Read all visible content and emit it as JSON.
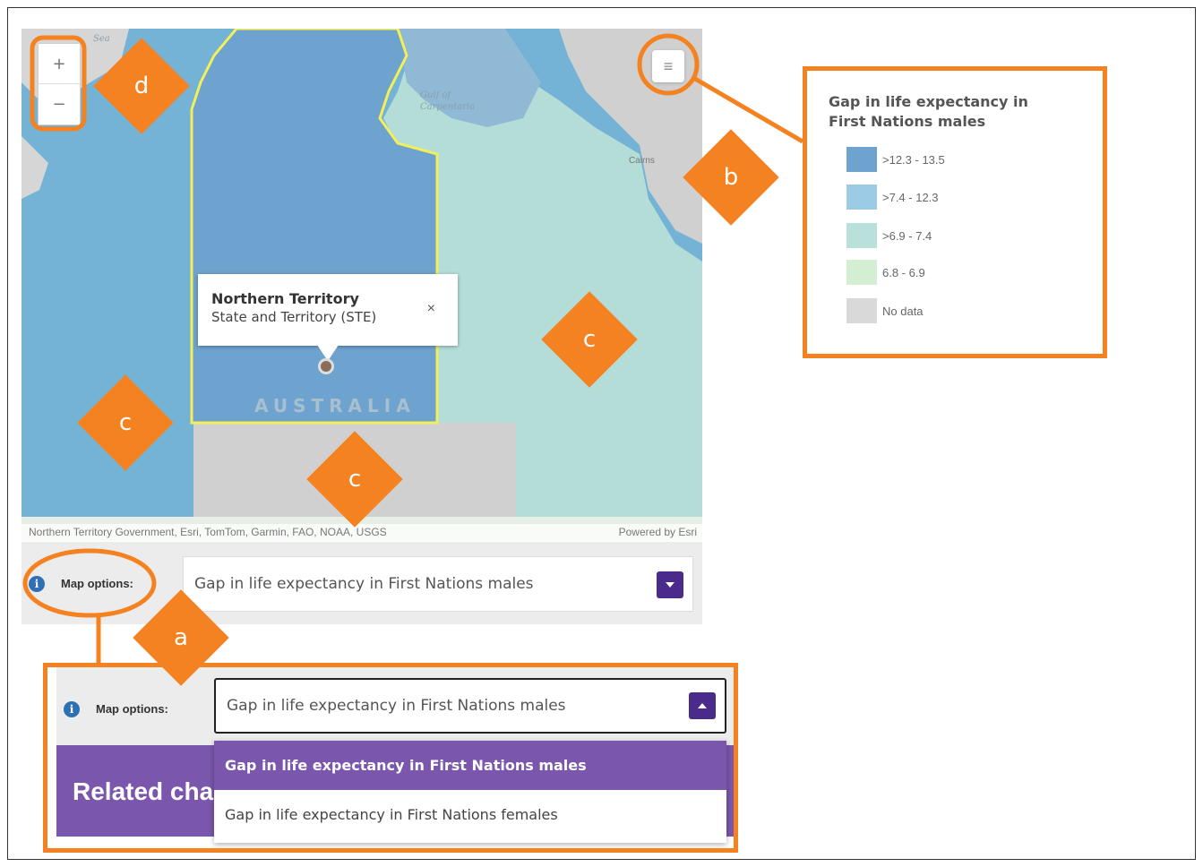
{
  "map": {
    "places": {
      "sea": "Sea",
      "gulf": "Gulf of Carpentaria",
      "cairns": "Cairns",
      "country": "AUSTRALIA"
    },
    "zoom_in": "+",
    "zoom_out": "−",
    "legend_button": "≡",
    "popup": {
      "title": "Northern Territory",
      "subtitle": "State and Territory (STE)",
      "close": "×"
    },
    "attribution": "Northern Territory Government, Esri, TomTom, Garmin, FAO, NOAA, USGS",
    "powered_by": "Powered by Esri"
  },
  "map_options": {
    "label": "Map options:",
    "selected": "Gap in life expectancy in First Nations males"
  },
  "legend": {
    "title": "Gap in life expectancy in First Nations males",
    "items": [
      {
        "label": ">12.3 - 13.5",
        "color": "#6fa3cf"
      },
      {
        "label": ">7.4 - 12.3",
        "color": "#9ccbe6"
      },
      {
        "label": ">6.9 - 7.4",
        "color": "#b9e0db"
      },
      {
        "label": "6.8 - 6.9",
        "color": "#d4eed3"
      },
      {
        "label": "No data",
        "color": "#d9d9d9"
      }
    ]
  },
  "expanded": {
    "label": "Map options:",
    "selected": "Gap in life expectancy in First Nations males",
    "related_title": "Related cha",
    "options": [
      "Gap in life expectancy in First Nations males",
      "Gap in life expectancy in First Nations females"
    ]
  },
  "callouts": {
    "a": "a",
    "b": "b",
    "c": "c",
    "d": "d"
  },
  "colors": {
    "callout": "#f58220",
    "accent_purple": "#7a57ad",
    "caret_purple": "#4a2a8a"
  }
}
